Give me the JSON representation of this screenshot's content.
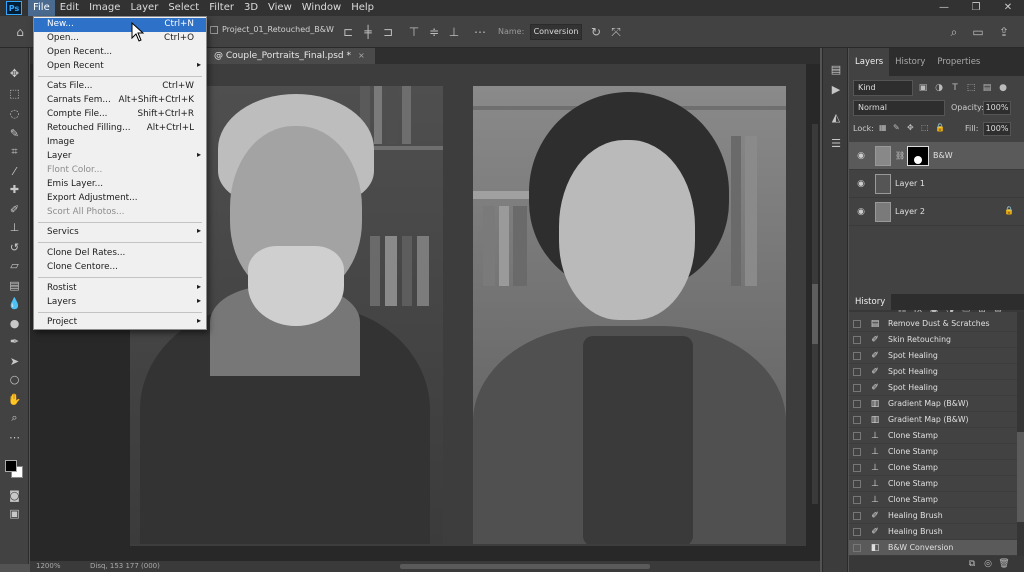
{
  "menubar": {
    "logo": "Ps",
    "items": [
      "File",
      "Edit",
      "Image",
      "Layer",
      "Select",
      "Filter",
      "3D",
      "View",
      "Window",
      "Help"
    ],
    "window_controls": [
      "—",
      "❐",
      "✕"
    ]
  },
  "options_bar": {
    "layer_name": "Project_01_Retouched_B&W",
    "name_label": "Name:",
    "name_value": "Conversion"
  },
  "document": {
    "tab_title": "@ Couple_Portraits_Final.psd *",
    "tab_close": "×"
  },
  "statusbar": {
    "zoom": "1200%",
    "doc_info": "Disq, 153 177 (000)"
  },
  "file_menu": {
    "items": [
      {
        "label": "New...",
        "shortcut": "Ctrl+N",
        "highlighted": true
      },
      {
        "label": "Open...",
        "shortcut": "Ctrl+O"
      },
      {
        "label": "Open Recent...",
        "shortcut": ""
      },
      {
        "label": "Open Recent",
        "shortcut": "",
        "submenu": true
      },
      {
        "label": "Cats File...",
        "shortcut": "Ctrl+W"
      },
      {
        "label": "Carnats Fem...",
        "shortcut": "Alt+Shift+Ctrl+K"
      },
      {
        "label": "Compte File...",
        "shortcut": "Shift+Ctrl+R"
      },
      {
        "label": "Retouched Filling...",
        "shortcut": "Alt+Ctrl+L"
      },
      {
        "label": "Image",
        "shortcut": ""
      },
      {
        "label": "Layer",
        "shortcut": "",
        "submenu": true
      },
      {
        "label": "Flont Color...",
        "shortcut": "",
        "disabled": true
      },
      {
        "label": "Emis Layer...",
        "shortcut": ""
      },
      {
        "label": "Export Adjustment...",
        "shortcut": ""
      },
      {
        "label": "Scort All Photos...",
        "shortcut": "",
        "disabled": true
      },
      {
        "label": "Servics",
        "shortcut": "",
        "submenu": true
      },
      {
        "label": "Clone Del Rates...",
        "shortcut": ""
      },
      {
        "label": "Clone Centore...",
        "shortcut": ""
      },
      {
        "label": "Rostist",
        "shortcut": "",
        "submenu": true
      },
      {
        "label": "Layers",
        "shortcut": "",
        "submenu": true
      },
      {
        "label": "Project",
        "shortcut": "",
        "submenu": true
      }
    ]
  },
  "layers_panel": {
    "tabs": [
      "Layers",
      "History",
      "Properties"
    ],
    "kind": "Kind",
    "blend_mode": "Normal",
    "opacity_label": "Opacity:",
    "opacity": "100%",
    "lock_label": "Lock:",
    "fill_label": "Fill:",
    "fill": "100%",
    "layers": [
      {
        "name": "B&W",
        "selected": true,
        "type": "adjustment"
      },
      {
        "name": "Layer 1",
        "selected": false,
        "type": "pixel"
      },
      {
        "name": "Layer 2",
        "selected": false,
        "type": "pixel",
        "locked": true
      }
    ]
  },
  "history_panel": {
    "tab": "History",
    "steps": [
      {
        "label": "Remove Dust & Scratches",
        "icon": "filter-icon"
      },
      {
        "label": "Skin Retouching",
        "icon": "brush-icon"
      },
      {
        "label": "Spot Healing",
        "icon": "brush-icon"
      },
      {
        "label": "Spot Healing",
        "icon": "brush-icon"
      },
      {
        "label": "Spot Healing",
        "icon": "brush-icon"
      },
      {
        "label": "Gradient Map (B&W)",
        "icon": "gradient-icon"
      },
      {
        "label": "Gradient Map (B&W)",
        "icon": "gradient-icon"
      },
      {
        "label": "Clone Stamp",
        "icon": "stamp-icon"
      },
      {
        "label": "Clone Stamp",
        "icon": "stamp-icon"
      },
      {
        "label": "Clone Stamp",
        "icon": "stamp-icon"
      },
      {
        "label": "Clone Stamp",
        "icon": "stamp-icon"
      },
      {
        "label": "Clone Stamp",
        "icon": "stamp-icon"
      },
      {
        "label": "Healing Brush",
        "icon": "brush-icon"
      },
      {
        "label": "Healing Brush",
        "icon": "brush-icon"
      },
      {
        "label": "B&W Conversion",
        "icon": "adjustment-icon",
        "current": true
      }
    ]
  }
}
